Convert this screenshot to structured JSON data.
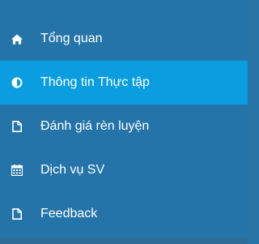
{
  "sidebar": {
    "items": [
      {
        "label": "Tổng quan",
        "icon": "home-icon",
        "active": false
      },
      {
        "label": "Thông tin Thực tập",
        "icon": "adjust-icon",
        "active": true
      },
      {
        "label": "Đánh giá rèn luyện",
        "icon": "file-icon",
        "active": false
      },
      {
        "label": "Dịch vụ SV",
        "icon": "calendar-icon",
        "active": false
      },
      {
        "label": "Feedback",
        "icon": "file-icon",
        "active": false
      }
    ]
  },
  "colors": {
    "background": "#2574a9",
    "active_background": "#0a9ee0",
    "text": "#ffffff"
  }
}
